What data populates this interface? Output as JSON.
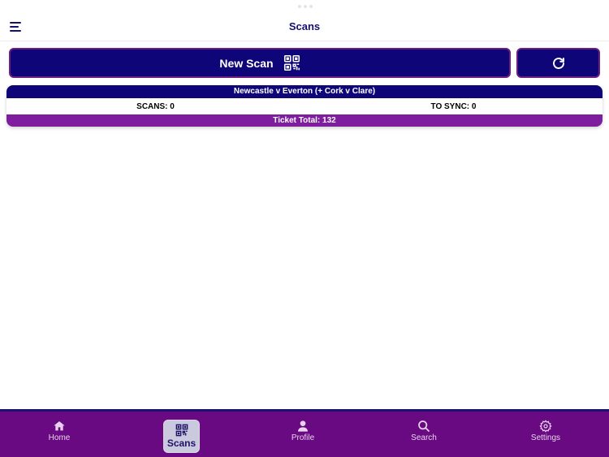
{
  "header": {
    "title": "Scans"
  },
  "actions": {
    "new_scan_label": "New Scan"
  },
  "event_card": {
    "title": "Newcastle v Everton (+ Cork v Clare)",
    "scans": "SCANS: 0",
    "to_sync": "TO SYNC: 0",
    "ticket_total": "Ticket Total: 132"
  },
  "tabs": [
    {
      "label": "Home",
      "icon": "home-icon"
    },
    {
      "label": "Scans",
      "icon": "qr-code-icon",
      "active": true
    },
    {
      "label": "Profile",
      "icon": "person-icon"
    },
    {
      "label": "Search",
      "icon": "search-icon"
    },
    {
      "label": "Settings",
      "icon": "gear-icon"
    }
  ],
  "colors": {
    "primary": "#0e0678",
    "accent_purple": "#7e1e9e",
    "tabbar": "#6a0a82",
    "title_text": "#14106b"
  }
}
